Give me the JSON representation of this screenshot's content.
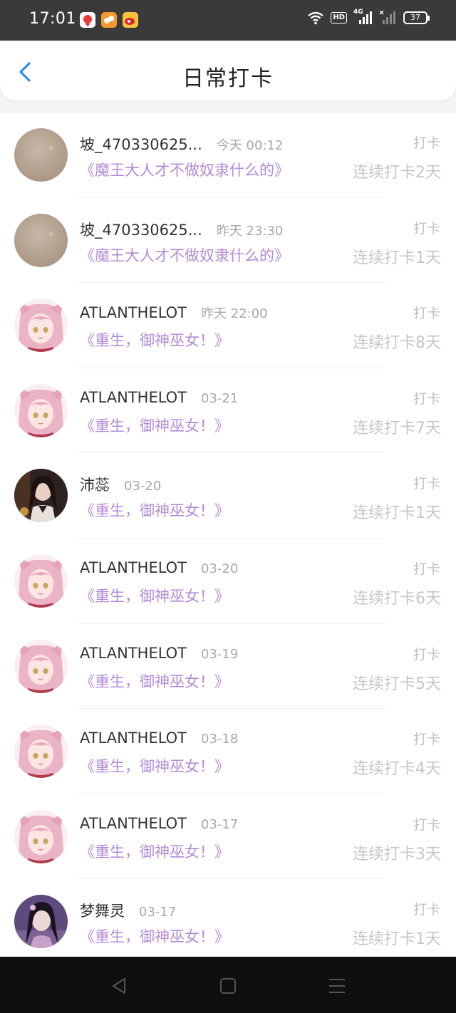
{
  "status_bar": {
    "time": "17:01",
    "hd_label": "HD",
    "network_label": "4G",
    "battery_level": "37",
    "notification_icons": [
      "app-red-icon",
      "app-orange-icon",
      "weibo-icon"
    ]
  },
  "header": {
    "title": "日常打卡",
    "back_icon": "chevron-left-icon"
  },
  "checkins": [
    {
      "user": "坡_470330625...",
      "time": "今天 00:12",
      "book": "《魔王大人才不做奴隶什么的》",
      "action": "打卡",
      "streak": "连续打卡2天",
      "avatar": "beige"
    },
    {
      "user": "坡_470330625...",
      "time": "昨天 23:30",
      "book": "《魔王大人才不做奴隶什么的》",
      "action": "打卡",
      "streak": "连续打卡1天",
      "avatar": "beige"
    },
    {
      "user": "ATLANTHELOT",
      "time": "昨天 22:00",
      "book": "《重生，御神巫女！》",
      "action": "打卡",
      "streak": "连续打卡8天",
      "avatar": "anime"
    },
    {
      "user": "ATLANTHELOT",
      "time": "03-21",
      "book": "《重生，御神巫女！》",
      "action": "打卡",
      "streak": "连续打卡7天",
      "avatar": "anime"
    },
    {
      "user": "沛蕊",
      "time": "03-20",
      "book": "《重生，御神巫女！》",
      "action": "打卡",
      "streak": "连续打卡1天",
      "avatar": "photo"
    },
    {
      "user": "ATLANTHELOT",
      "time": "03-20",
      "book": "《重生，御神巫女！》",
      "action": "打卡",
      "streak": "连续打卡6天",
      "avatar": "anime"
    },
    {
      "user": "ATLANTHELOT",
      "time": "03-19",
      "book": "《重生，御神巫女！》",
      "action": "打卡",
      "streak": "连续打卡5天",
      "avatar": "anime"
    },
    {
      "user": "ATLANTHELOT",
      "time": "03-18",
      "book": "《重生，御神巫女！》",
      "action": "打卡",
      "streak": "连续打卡4天",
      "avatar": "anime"
    },
    {
      "user": "ATLANTHELOT",
      "time": "03-17",
      "book": "《重生，御神巫女！》",
      "action": "打卡",
      "streak": "连续打卡3天",
      "avatar": "anime"
    },
    {
      "user": "梦舞灵",
      "time": "03-17",
      "book": "《重生，御神巫女！》",
      "action": "打卡",
      "streak": "连续打卡1天",
      "avatar": "photo-purple"
    }
  ],
  "nav_bar": {
    "icons": [
      "nav-back-icon",
      "nav-home-icon",
      "nav-menu-icon"
    ]
  },
  "colors": {
    "book_title": "#b48ad7",
    "back_icon": "#2f8ee8",
    "status_bar_bg": "#3a3a3a",
    "nav_bar_bg": "#0f0f0f"
  }
}
